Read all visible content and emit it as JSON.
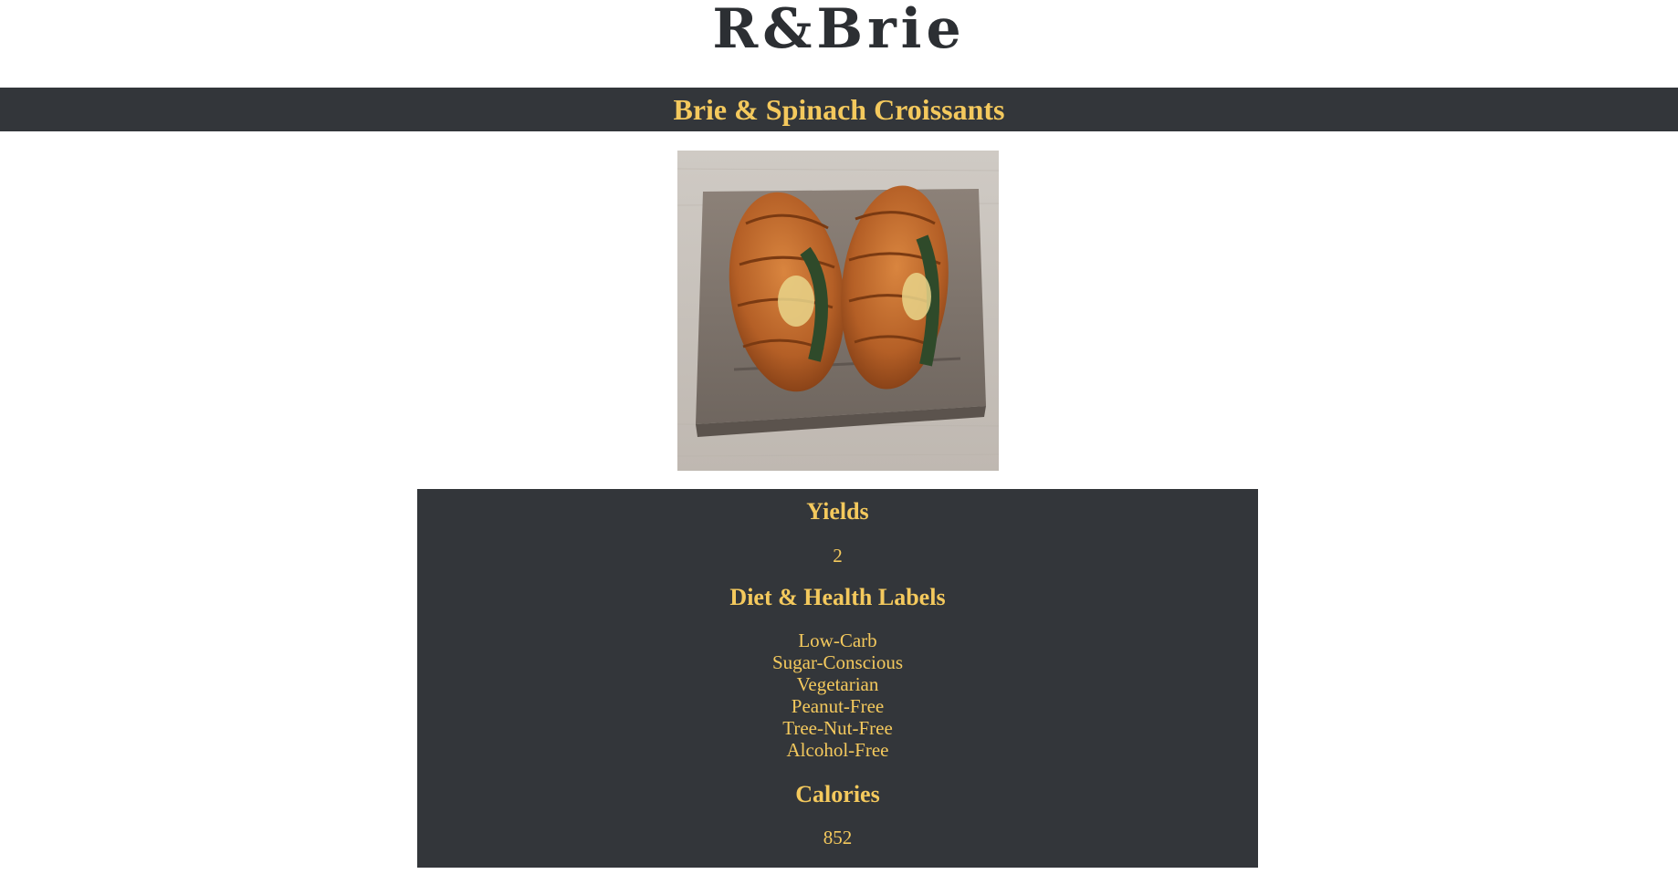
{
  "site": {
    "brand": "R&Brie"
  },
  "recipe": {
    "title": "Brie & Spinach Croissants",
    "image_alt": "croissant sandwiches on a wooden board",
    "sections": {
      "yields_heading": "Yields",
      "yields_value": "2",
      "labels_heading": "Diet & Health Labels",
      "labels": [
        "Low-Carb",
        "Sugar-Conscious",
        "Vegetarian",
        "Peanut-Free",
        "Tree-Nut-Free",
        "Alcohol-Free"
      ],
      "calories_heading": "Calories",
      "calories_value": "852"
    }
  },
  "colors": {
    "dark_bar": "#33363a",
    "accent_gold": "#f4c95d",
    "brand_text": "#2c2f33"
  }
}
